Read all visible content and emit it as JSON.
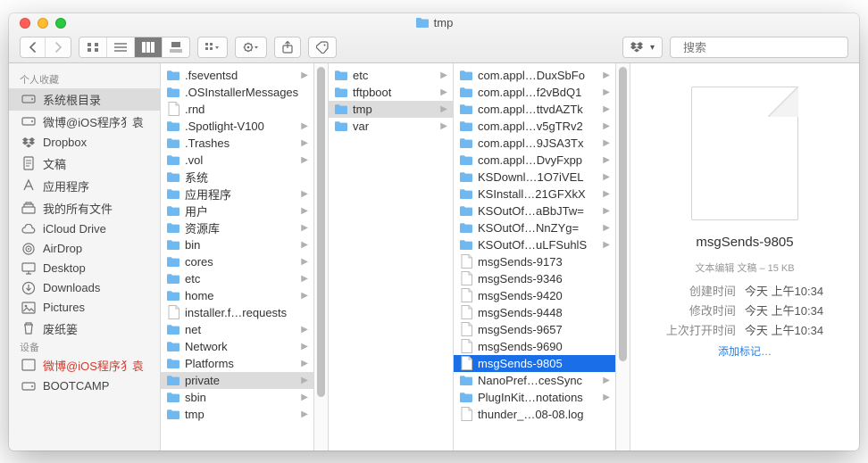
{
  "title": "tmp",
  "search_placeholder": "搜索",
  "sidebar": {
    "header1": "个人收藏",
    "header2": "设备",
    "fav": [
      {
        "icon": "disk",
        "label": "系统根目录",
        "selected": true
      },
      {
        "icon": "disk",
        "label": "微博@iOS程序犭袁"
      },
      {
        "icon": "dropbox",
        "label": "Dropbox"
      },
      {
        "icon": "doc",
        "label": "文稿"
      },
      {
        "icon": "app",
        "label": "应用程序"
      },
      {
        "icon": "allfiles",
        "label": "我的所有文件"
      },
      {
        "icon": "cloud",
        "label": "iCloud Drive"
      },
      {
        "icon": "airdrop",
        "label": "AirDrop"
      },
      {
        "icon": "desktop",
        "label": "Desktop"
      },
      {
        "icon": "download",
        "label": "Downloads"
      },
      {
        "icon": "pic",
        "label": "Pictures"
      },
      {
        "icon": "trash",
        "label": "废纸篓"
      }
    ],
    "dev": [
      {
        "icon": "blog",
        "label": "微博@iOS程序犭袁",
        "red": true
      },
      {
        "icon": "disk",
        "label": "BOOTCAMP"
      }
    ]
  },
  "col1": [
    {
      "t": "folder",
      "n": ".fseventsd",
      "c": true
    },
    {
      "t": "folder",
      "n": ".OSInstallerMessages"
    },
    {
      "t": "file",
      "n": ".rnd"
    },
    {
      "t": "folder",
      "n": ".Spotlight-V100",
      "c": true
    },
    {
      "t": "folder",
      "n": ".Trashes",
      "c": true
    },
    {
      "t": "folder",
      "n": ".vol",
      "c": true
    },
    {
      "t": "folder",
      "n": "系统"
    },
    {
      "t": "folder",
      "n": "应用程序",
      "c": true
    },
    {
      "t": "folder",
      "n": "用户",
      "c": true
    },
    {
      "t": "folder",
      "n": "资源库",
      "c": true
    },
    {
      "t": "folder",
      "n": "bin",
      "c": true
    },
    {
      "t": "folder",
      "n": "cores",
      "c": true
    },
    {
      "t": "folder",
      "n": "etc",
      "c": true
    },
    {
      "t": "folder",
      "n": "home",
      "c": true
    },
    {
      "t": "file",
      "n": "installer.f…requests"
    },
    {
      "t": "folder",
      "n": "net",
      "c": true
    },
    {
      "t": "folder",
      "n": "Network",
      "c": true
    },
    {
      "t": "folder",
      "n": "Platforms",
      "c": true
    },
    {
      "t": "folder",
      "n": "private",
      "c": true,
      "sel": true
    },
    {
      "t": "folder",
      "n": "sbin",
      "c": true
    },
    {
      "t": "folder",
      "n": "tmp",
      "c": true
    }
  ],
  "col2": [
    {
      "t": "folder",
      "n": "etc",
      "c": true
    },
    {
      "t": "folder",
      "n": "tftpboot",
      "c": true
    },
    {
      "t": "folder",
      "n": "tmp",
      "c": true,
      "sel": true
    },
    {
      "t": "folder",
      "n": "var",
      "c": true
    }
  ],
  "col3": [
    {
      "t": "folder",
      "n": "com.appl…DuxSbFo",
      "c": true
    },
    {
      "t": "folder",
      "n": "com.appl…f2vBdQ1",
      "c": true
    },
    {
      "t": "folder",
      "n": "com.appl…ttvdAZTk",
      "c": true
    },
    {
      "t": "folder",
      "n": "com.appl…v5gTRv2",
      "c": true
    },
    {
      "t": "folder",
      "n": "com.appl…9JSA3Tx",
      "c": true
    },
    {
      "t": "folder",
      "n": "com.appl…DvyFxpp",
      "c": true
    },
    {
      "t": "folder",
      "n": "KSDownl…1O7iVEL",
      "c": true
    },
    {
      "t": "folder",
      "n": "KSInstall…21GFXkX",
      "c": true
    },
    {
      "t": "folder",
      "n": "KSOutOf…aBbJTw=",
      "c": true
    },
    {
      "t": "folder",
      "n": "KSOutOf…NnZYg=",
      "c": true
    },
    {
      "t": "folder",
      "n": "KSOutOf…uLFSuhlS",
      "c": true
    },
    {
      "t": "file",
      "n": "msgSends-9173"
    },
    {
      "t": "file",
      "n": "msgSends-9346"
    },
    {
      "t": "file",
      "n": "msgSends-9420"
    },
    {
      "t": "file",
      "n": "msgSends-9448"
    },
    {
      "t": "file",
      "n": "msgSends-9657"
    },
    {
      "t": "file",
      "n": "msgSends-9690"
    },
    {
      "t": "file",
      "n": "msgSends-9805",
      "selblue": true
    },
    {
      "t": "folder",
      "n": "NanoPref…cesSync",
      "c": true
    },
    {
      "t": "folder",
      "n": "PlugInKit…notations",
      "c": true
    },
    {
      "t": "file",
      "n": "thunder_…08-08.log"
    }
  ],
  "preview": {
    "name": "msgSends-9805",
    "kind": "文本编辑 文稿 – 15 KB",
    "rows": [
      {
        "k": "创建时间",
        "v": "今天 上午10:34"
      },
      {
        "k": "修改时间",
        "v": "今天 上午10:34"
      },
      {
        "k": "上次打开时间",
        "v": "今天 上午10:34"
      }
    ],
    "addtag": "添加标记…"
  }
}
